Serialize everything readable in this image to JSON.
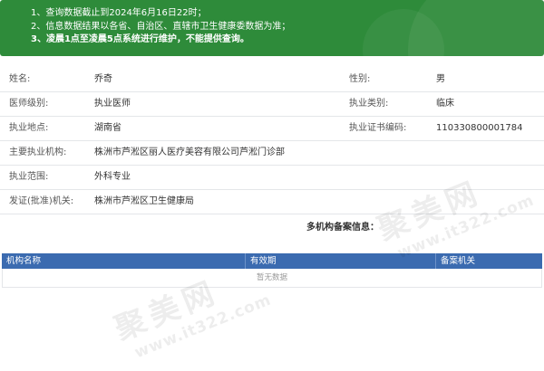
{
  "notice": {
    "lines": [
      "1、查询数据截止到2024年6月16日22时；",
      "2、信息数据结果以各省、自治区、直辖市卫生健康委数据为准；",
      "3、凌晨1点至凌晨5点系统进行维护，不能提供查询。"
    ]
  },
  "info": {
    "rows": [
      {
        "label": "姓名:",
        "value": "乔奇",
        "label2": "性别:",
        "value2": "男"
      },
      {
        "label": "医师级别:",
        "value": "执业医师",
        "label2": "执业类别:",
        "value2": "临床"
      },
      {
        "label": "执业地点:",
        "value": "湖南省",
        "label2": "执业证书编码:",
        "value2": "110330800001784"
      },
      {
        "label": "主要执业机构:",
        "value": "株洲市芦淞区丽人医疗美容有限公司芦淞门诊部"
      },
      {
        "label": "执业范围:",
        "value": "外科专业"
      },
      {
        "label": "发证(批准)机关:",
        "value": "株洲市芦淞区卫生健康局"
      }
    ]
  },
  "multi": {
    "title": "多机构备案信息：",
    "columns": [
      "机构名称",
      "有效期",
      "备案机关"
    ],
    "empty_text": "暂无数据"
  },
  "watermark": {
    "brand": "聚美网",
    "url": "www.it322.com"
  }
}
